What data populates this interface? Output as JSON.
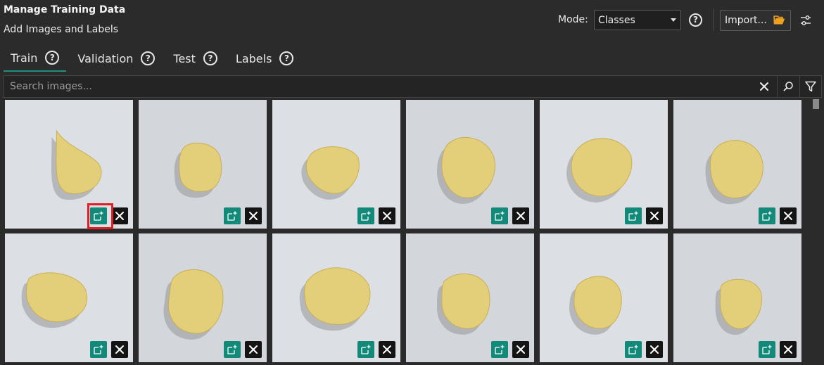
{
  "header": {
    "title": "Manage Training Data",
    "subtitle": "Add Images and Labels",
    "mode_label": "Mode:",
    "mode_value": "Classes",
    "help_glyph": "?",
    "import_label": "Import..."
  },
  "tabs": [
    {
      "label": "Train",
      "active": true
    },
    {
      "label": "Validation",
      "active": false
    },
    {
      "label": "Test",
      "active": false
    },
    {
      "label": "Labels",
      "active": false
    }
  ],
  "search": {
    "placeholder": "Search images..."
  },
  "colors": {
    "accent": "#13897a",
    "tab_underline": "#1e8f7f",
    "highlight": "#e01e24",
    "background": "#2b2b2b"
  },
  "grid": {
    "rows": 2,
    "columns": 6,
    "visible_tiles": 12,
    "highlighted_tile": 1,
    "tile_content": "potato chip on white background"
  },
  "icons": {
    "tile_label_icon": "add-label-icon",
    "tile_remove_icon": "close-icon",
    "import_icon": "folder-open-icon",
    "settings_icon": "sliders-icon",
    "search_icon": "search-icon",
    "filter_icon": "filter-icon"
  }
}
